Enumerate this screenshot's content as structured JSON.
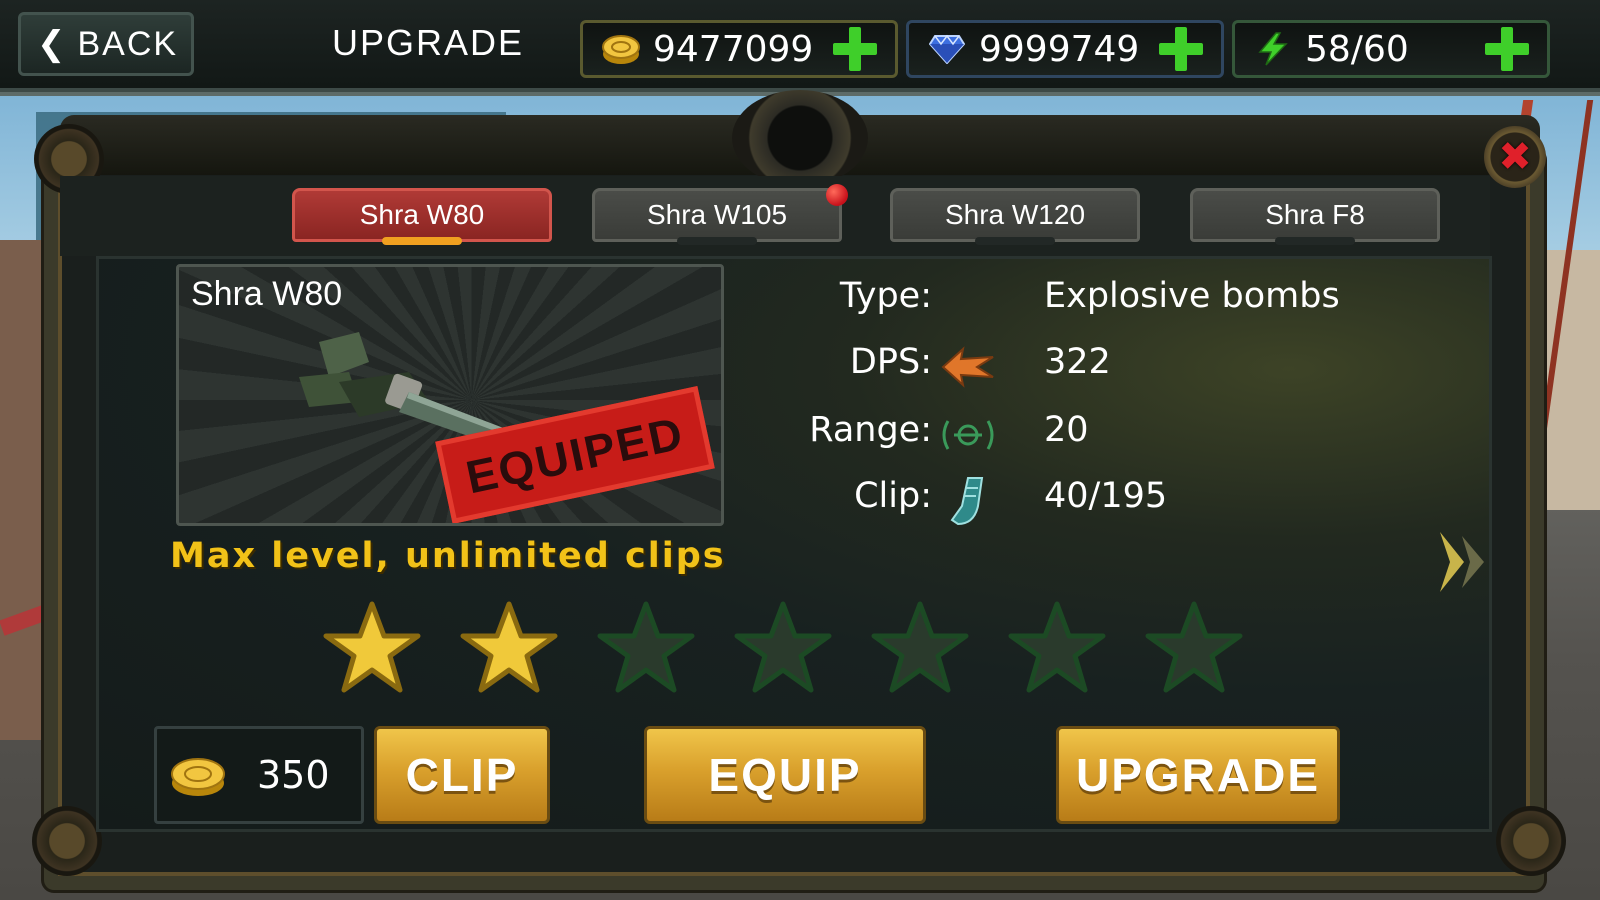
{
  "topbar": {
    "back_label": "BACK",
    "title": "UPGRADE",
    "currencies": [
      {
        "name": "gold",
        "icon": "gold-coin-icon",
        "value": "9477099"
      },
      {
        "name": "gems",
        "icon": "diamond-icon",
        "value": "9999749"
      },
      {
        "name": "energy",
        "icon": "energy-bolt-icon",
        "value": "58/60"
      }
    ]
  },
  "tabs": [
    {
      "label": "Shra W80",
      "active": true,
      "notification": false
    },
    {
      "label": "Shra W105",
      "active": false,
      "notification": true
    },
    {
      "label": "Shra W120",
      "active": false,
      "notification": false
    },
    {
      "label": "Shra F8",
      "active": false,
      "notification": false
    }
  ],
  "weapon": {
    "name": "Shra W80",
    "status_stamp": "EQUIPED",
    "note": "Max level, unlimited clips",
    "stats": [
      {
        "label": "Type:",
        "icon": "",
        "value": "Explosive bombs"
      },
      {
        "label": "DPS:",
        "icon": "dps-arrow-icon",
        "value": "322"
      },
      {
        "label": "Range:",
        "icon": "range-target-icon",
        "value": "20"
      },
      {
        "label": "Clip:",
        "icon": "ammo-clip-icon",
        "value": "40/195"
      }
    ],
    "stars_filled": 2,
    "stars_total": 7
  },
  "actions": {
    "clip_cost": "350",
    "clip_label": "CLIP",
    "equip_label": "EQUIP",
    "upgrade_label": "UPGRADE"
  },
  "colors": {
    "accent_gold": "#f2c218",
    "tab_active": "#b03a36",
    "plus_green": "#3fcf2a",
    "close_red": "#e0202a",
    "button_gold": "#d9a02c"
  }
}
